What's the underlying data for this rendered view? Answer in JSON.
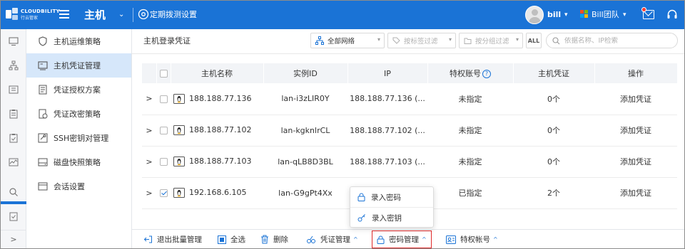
{
  "header": {
    "logo_text": "CLOUDBILITY",
    "logo_sub": "行云管家",
    "module_title": "主机",
    "dial_label": "定期拨测设置",
    "user_name": "bill",
    "team_name": "Bill团队",
    "colors": {
      "primary": "#1a73d6",
      "notification_dot": "#ff3b30"
    }
  },
  "rail": {
    "items": [
      "monitor-icon",
      "topology-icon",
      "inbox-icon",
      "clipboard-icon",
      "clipboard-check-icon",
      "chart-icon",
      "search-icon",
      "audit-icon"
    ],
    "expand_glyph": ">"
  },
  "subnav": {
    "items": [
      {
        "label": "主机运维策略",
        "icon": "shield-icon",
        "active": false
      },
      {
        "label": "主机凭证管理",
        "icon": "credential-icon",
        "active": true
      },
      {
        "label": "凭证授权方案",
        "icon": "authorization-icon",
        "active": false
      },
      {
        "label": "凭证改密策略",
        "icon": "password-change-icon",
        "active": false
      },
      {
        "label": "SSH密钥对管理",
        "icon": "ssh-key-icon",
        "active": false
      },
      {
        "label": "磁盘快照策略",
        "icon": "disk-snapshot-icon",
        "active": false
      },
      {
        "label": "会话设置",
        "icon": "session-icon",
        "active": false
      }
    ]
  },
  "main": {
    "title": "主机登录凭证",
    "filters": {
      "network": "全部网络",
      "tag_placeholder": "按标签过滤",
      "group_placeholder": "按分组过滤",
      "all_label": "ALL",
      "search_placeholder": "依据名称、IP检索"
    },
    "table": {
      "columns": [
        "主机名称",
        "实例ID",
        "IP",
        "特权账号",
        "主机凭证",
        "操作"
      ],
      "help_glyph": "?",
      "rows": [
        {
          "expand": ">",
          "checked": false,
          "host": "188.188.77.136",
          "instance_id": "lan-i3zLIR0Y",
          "ip": "188.188.77.136 (...",
          "privileged": "未指定",
          "privileged_status": "unassigned",
          "credentials": "0个",
          "action": "添加凭证"
        },
        {
          "expand": ">",
          "checked": false,
          "host": "188.188.77.102",
          "instance_id": "lan-kgknlrCL",
          "ip": "188.188.77.102 (...",
          "privileged": "未指定",
          "privileged_status": "unassigned",
          "credentials": "0个",
          "action": "添加凭证"
        },
        {
          "expand": ">",
          "checked": false,
          "host": "188.188.77.103",
          "instance_id": "lan-qLB8D3BL",
          "ip": "188.188.77.103 (...",
          "privileged": "未指定",
          "privileged_status": "unassigned",
          "credentials": "0个",
          "action": "添加凭证"
        },
        {
          "expand": ">",
          "checked": true,
          "host": "192.168.6.105",
          "instance_id": "lan-G9gPt4Xx",
          "ip": "",
          "privileged": "已指定",
          "privileged_status": "assigned",
          "credentials": "2个",
          "action": "添加凭证"
        }
      ]
    }
  },
  "popup": {
    "items": [
      {
        "label": "录入密码",
        "icon": "lock-icon"
      },
      {
        "label": "录入密钥",
        "icon": "key-icon"
      }
    ]
  },
  "toolbar": {
    "exit_batch": "退出批量管理",
    "select_all": "全选",
    "delete": "删除",
    "credential_mgmt": "凭证管理",
    "password_mgmt": "密码管理",
    "privileged_account": "特权帐号",
    "caret": "^"
  }
}
